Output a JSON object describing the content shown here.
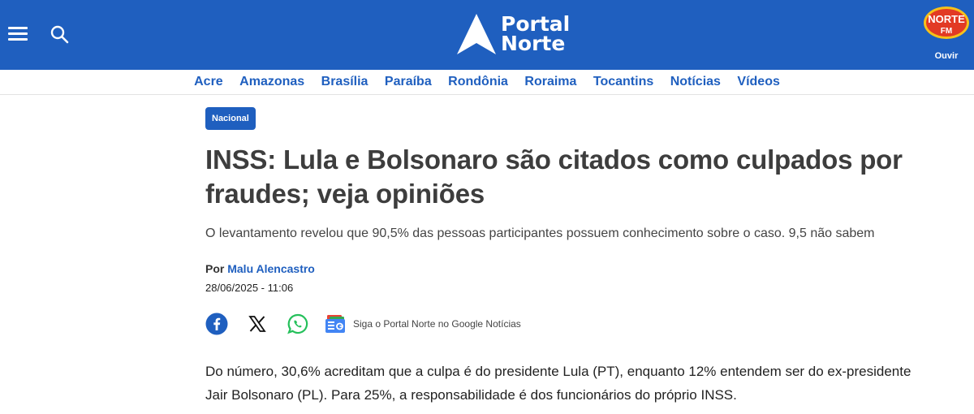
{
  "header": {
    "logo_line1": "Portal",
    "logo_line2": "Norte",
    "radio_label": "Ouvir",
    "radio_badge_line1": "NORTE",
    "radio_badge_line2": "FM"
  },
  "nav": {
    "items": [
      "Acre",
      "Amazonas",
      "Brasília",
      "Paraíba",
      "Rondônia",
      "Roraima",
      "Tocantins",
      "Notícias",
      "Vídeos"
    ]
  },
  "article": {
    "category": "Nacional",
    "title": "INSS: Lula e Bolsonaro são citados como culpados por fraudes; veja opiniões",
    "subtitle": "O levantamento revelou que 90,5% das pessoas participantes possuem conhecimento sobre o caso. 9,5 não sabem",
    "by_prefix": "Por",
    "author": "Malu Alencastro",
    "date": "28/06/2025 - 11:06",
    "google_news_label": "Siga o Portal Norte no Google Notícias",
    "body": "Do número, 30,6% acreditam que a culpa é do presidente Lula (PT), enquanto 12% entendem ser do ex-presidente Jair Bolsonaro (PL). Para 25%, a responsabilidade é dos funcionários do próprio INSS."
  },
  "colors": {
    "brand_blue": "#1f5fbf",
    "radio_red": "#e23a24",
    "radio_yellow": "#f6c11a"
  },
  "icons": [
    "menu-icon",
    "search-icon",
    "facebook-icon",
    "x-icon",
    "whatsapp-icon",
    "google-news-icon"
  ]
}
